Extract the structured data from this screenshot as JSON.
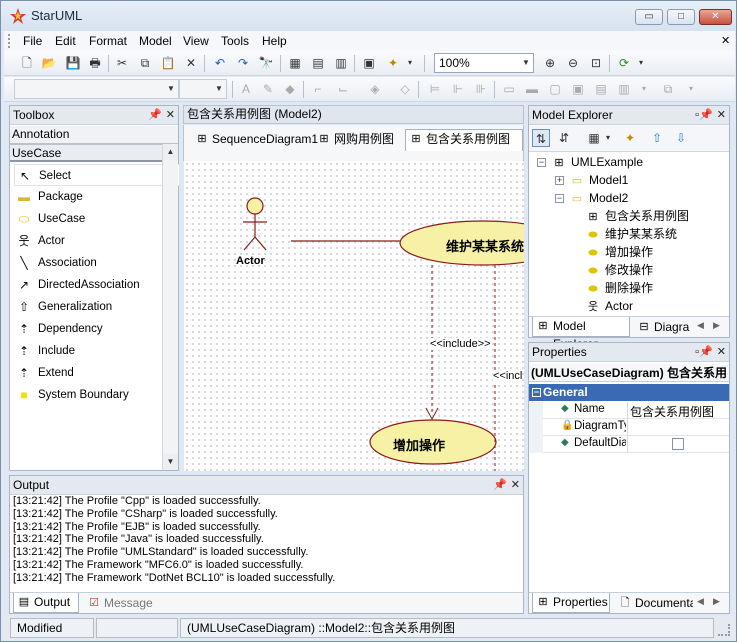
{
  "app": {
    "title": "StarUML"
  },
  "window_controls": {
    "minimize": "▭",
    "maximize": "□",
    "close": "✕"
  },
  "menu": {
    "items": [
      "File",
      "Edit",
      "Format",
      "Model",
      "View",
      "Tools",
      "Help"
    ]
  },
  "toolbar": {
    "zoom": "100%"
  },
  "toolbox": {
    "title": "Toolbox",
    "sections": [
      "Annotation",
      "UseCase"
    ],
    "items": [
      {
        "label": "Select",
        "icon": "cursor-icon"
      },
      {
        "label": "Package",
        "icon": "package-icon"
      },
      {
        "label": "UseCase",
        "icon": "usecase-icon"
      },
      {
        "label": "Actor",
        "icon": "actor-icon"
      },
      {
        "label": "Association",
        "icon": "association-icon"
      },
      {
        "label": "DirectedAssociation",
        "icon": "directed-association-icon"
      },
      {
        "label": "Generalization",
        "icon": "generalization-icon"
      },
      {
        "label": "Dependency",
        "icon": "dependency-icon"
      },
      {
        "label": "Include",
        "icon": "include-icon"
      },
      {
        "label": "Extend",
        "icon": "extend-icon"
      },
      {
        "label": "System Boundary",
        "icon": "system-boundary-icon"
      }
    ]
  },
  "diagram": {
    "header": "包含关系用例图 (Model2)",
    "tabs": [
      "SequenceDiagram1",
      "网购用例图",
      "包含关系用例图"
    ],
    "actor_label": "Actor",
    "usecase_main": "维护某某系统",
    "usecase_add": "增加操作",
    "include_label": "<<include>>",
    "include_label2": "<<incl",
    "accent": "#8b1a1a"
  },
  "model_explorer": {
    "title": "Model Explorer",
    "tree": [
      {
        "label": "UMLExample",
        "level": 0,
        "icon": "project-icon"
      },
      {
        "label": "Model1",
        "level": 1,
        "icon": "model-icon"
      },
      {
        "label": "Model2",
        "level": 1,
        "icon": "model-icon"
      },
      {
        "label": "包含关系用例图",
        "level": 2,
        "icon": "diagram-icon"
      },
      {
        "label": "维护某某系统",
        "level": 2,
        "icon": "usecase-icon"
      },
      {
        "label": "增加操作",
        "level": 2,
        "icon": "usecase-icon"
      },
      {
        "label": "修改操作",
        "level": 2,
        "icon": "usecase-icon"
      },
      {
        "label": "删除操作",
        "level": 2,
        "icon": "usecase-icon"
      },
      {
        "label": "Actor",
        "level": 2,
        "icon": "actor-icon"
      }
    ],
    "tabs": [
      "Model Explorer",
      "Diagra"
    ]
  },
  "properties": {
    "title": "Properties",
    "element": "(UMLUseCaseDiagram) 包含关系用",
    "group": "General",
    "rows": [
      {
        "name": "Name",
        "value": "包含关系用例图"
      },
      {
        "name": "DiagramTy",
        "value": ""
      },
      {
        "name": "DefaultDia",
        "value": ""
      }
    ],
    "tabs": [
      "Properties",
      "Documenta"
    ]
  },
  "output": {
    "title": "Output",
    "lines": [
      "[13:21:42]  The Profile \"Cpp\" is loaded successfully.",
      "[13:21:42]  The Profile \"CSharp\" is loaded successfully.",
      "[13:21:42]  The Profile \"EJB\" is loaded successfully.",
      "[13:21:42]  The Profile \"Java\" is loaded successfully.",
      "[13:21:42]  The Profile \"UMLStandard\" is loaded successfully.",
      "[13:21:42]  The Framework \"MFC6.0\" is loaded successfully.",
      "[13:21:42]  The Framework \"DotNet BCL10\" is loaded successfully."
    ],
    "tabs": [
      "Output",
      "Message"
    ]
  },
  "status": {
    "mode": "Modified",
    "path": "(UMLUseCaseDiagram) ::Model2::包含关系用例图"
  }
}
